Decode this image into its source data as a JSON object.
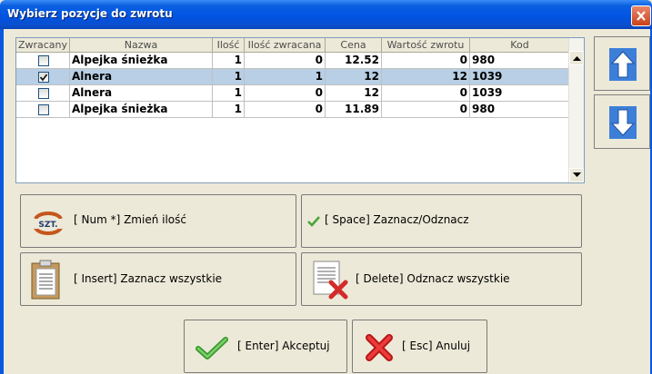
{
  "window": {
    "title": "Wybierz pozycje do zwrotu"
  },
  "table": {
    "headers": [
      "Zwracany",
      "Nazwa",
      "Ilość",
      "Ilość zwracana",
      "Cena",
      "Wartość zwrotu",
      "Kod"
    ],
    "rows": [
      {
        "checked": false,
        "selected": false,
        "nazwa": "Alpejka śnieżka",
        "ilosc": "1",
        "ilosc_zwracana": "0",
        "cena": "12.52",
        "wartosc": "0",
        "kod": "980"
      },
      {
        "checked": true,
        "selected": true,
        "nazwa": "Alnera",
        "ilosc": "1",
        "ilosc_zwracana": "1",
        "cena": "12",
        "wartosc": "12",
        "kod": "1039"
      },
      {
        "checked": false,
        "selected": false,
        "nazwa": "Alnera",
        "ilosc": "1",
        "ilosc_zwracana": "0",
        "cena": "12",
        "wartosc": "0",
        "kod": "1039"
      },
      {
        "checked": false,
        "selected": false,
        "nazwa": "Alpejka śnieżka",
        "ilosc": "1",
        "ilosc_zwracana": "0",
        "cena": "11.89",
        "wartosc": "0",
        "kod": "980"
      }
    ]
  },
  "actions": {
    "change_qty": "[ Num *] Zmień ilość",
    "change_qty_icon_text": "SZT.",
    "toggle": "[ Space] Zaznacz/Odznacz",
    "select_all": "[ Insert] Zaznacz wszystkie",
    "deselect_all": "[ Delete] Odznacz wszystkie",
    "accept": "[ Enter] Akceptuj",
    "cancel": "[ Esc] Anuluj"
  },
  "colors": {
    "title_bar": "#0054e3",
    "selected_row": "#b8cfe5",
    "dialog_bg": "#ece9d8",
    "accent_blue": "#2f6fd0"
  },
  "icons": [
    "close-icon",
    "arrow-up-icon",
    "arrow-down-icon",
    "scroll-up-icon",
    "scroll-down-icon",
    "szt-refresh-icon",
    "checkmark-icon",
    "clipboard-icon",
    "document-x-icon",
    "cross-icon"
  ]
}
